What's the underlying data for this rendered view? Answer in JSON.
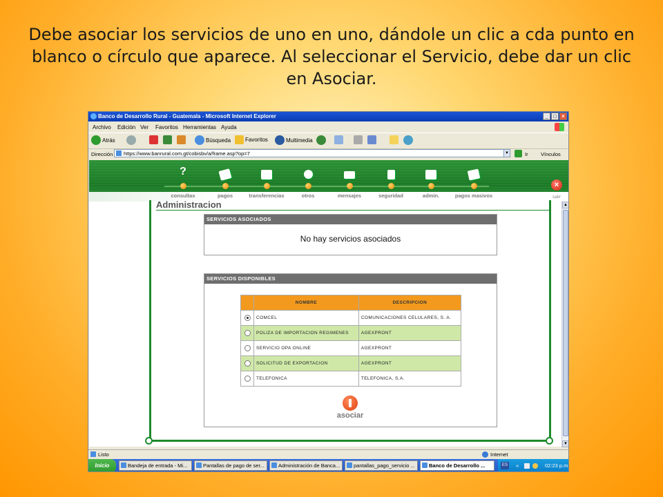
{
  "caption": "Debe asociar los servicios de uno en uno, dándole un clic a cda punto en blanco o círculo que aparece. Al seleccionar el Servicio, debe dar un clic en Asociar.",
  "window": {
    "title": "Banco de Desarrollo Rural - Guatemala - Microsoft Internet Explorer",
    "buttons": [
      "_",
      "□",
      "×"
    ]
  },
  "menu": [
    "Archivo",
    "Edición",
    "Ver",
    "Favoritos",
    "Herramientas",
    "Ayuda"
  ],
  "toolbar": {
    "back": "Atrás",
    "search": "Búsqueda",
    "favorites": "Favoritos",
    "multimedia": "Multimedia"
  },
  "address": {
    "label": "Dirección",
    "url": "https://www.banrural.com.gt/cobisbv/a/frame.asp?op=7",
    "go": "Ir",
    "links": "Vínculos"
  },
  "nav": {
    "items": [
      {
        "label": "consultas",
        "icon": "question-icon"
      },
      {
        "label": "pagos",
        "icon": "payment-icon"
      },
      {
        "label": "transferencias",
        "icon": "transfer-icon"
      },
      {
        "label": "otros",
        "icon": "smiley-icon"
      },
      {
        "label": "mensajes",
        "icon": "envelope-icon"
      },
      {
        "label": "seguridad",
        "icon": "lock-icon"
      },
      {
        "label": "admin.",
        "icon": "admin-icon"
      },
      {
        "label": "pagos masivos",
        "icon": "mass-payment-icon"
      }
    ],
    "salir": "salir"
  },
  "page": {
    "title": "Administracion",
    "asociados": {
      "header": "SERVICIOS ASOCIADOS",
      "message": "No hay servicios asociados"
    },
    "disponibles": {
      "header": "SERVICIOS DISPONIBLES",
      "columns": [
        "NOMBRE",
        "DESCRIPCION"
      ],
      "rows": [
        {
          "nombre": "COMCEL",
          "descripcion": "COMUNICACIONES CELULARES, S. A.",
          "selected": true
        },
        {
          "nombre": "POLIZA DE IMPORTACION REGIMENES",
          "descripcion": "AGEXPRONT",
          "selected": false
        },
        {
          "nombre": "SERVICIO OPA ONLINE",
          "descripcion": "AGEXPRONT",
          "selected": false
        },
        {
          "nombre": "SOLICITUD DE EXPORTACION",
          "descripcion": "AGEXPRONT",
          "selected": false
        },
        {
          "nombre": "TELEFONICA",
          "descripcion": "TELEFONICA, S.A.",
          "selected": false
        }
      ]
    },
    "asociar": "asociar"
  },
  "status": {
    "text": "Listo",
    "zone": "Internet"
  },
  "taskbar": {
    "start": "Inicio",
    "tasks": [
      "Bandeja de entrada - Mi...",
      "Pantallas de pago de ser...",
      "Administración de Banca...",
      "pantallas_pago_servicio ...",
      "Banco de Desarrollo ..."
    ],
    "lang": "ES",
    "chevron": "«",
    "clock": "02:23 p.m."
  },
  "colors": {
    "nav_green": "#1e8a2c",
    "orange_header": "#f39a1e",
    "row_highlight": "#cfe8a8",
    "panel_header": "#6e6e6e"
  }
}
